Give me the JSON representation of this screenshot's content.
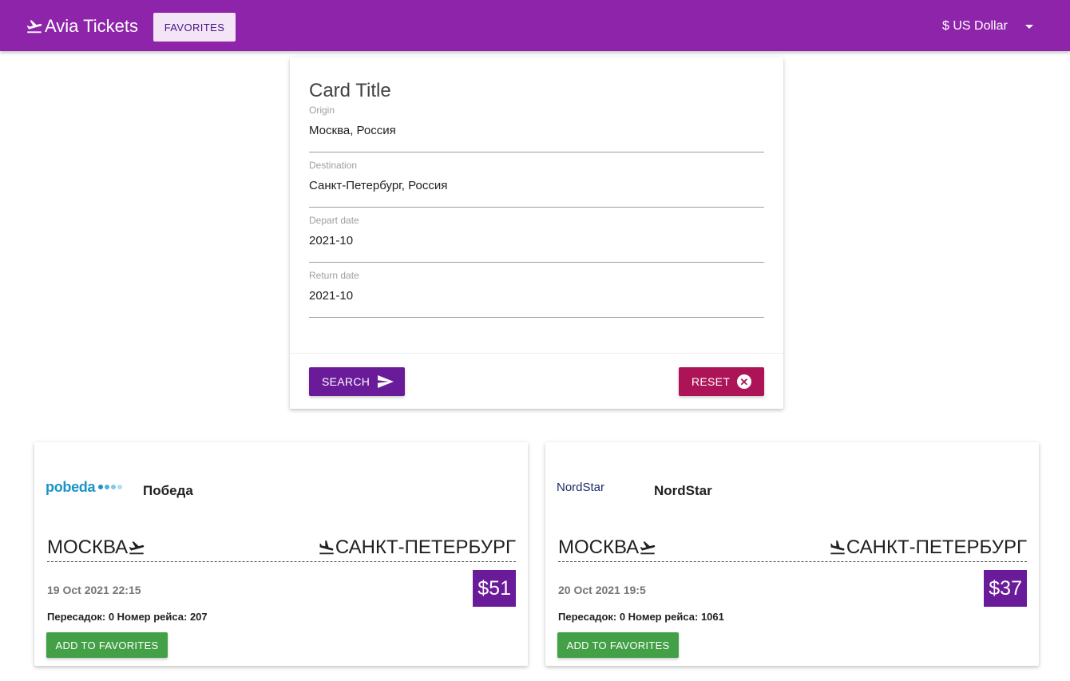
{
  "header": {
    "brand": "Avia Tickets",
    "brand_icon": "airplane-takeoff-icon",
    "favorites_label": "FAVORITES",
    "currency_label": "$ US Dollar",
    "bg_color": "#8e24aa"
  },
  "form": {
    "title": "Card Title",
    "fields": [
      {
        "label": "Origin",
        "value": "Москва, Россия"
      },
      {
        "label": "Destination",
        "value": "Санкт-Петербург, Россия"
      },
      {
        "label": "Depart date",
        "value": "2021-10"
      },
      {
        "label": "Return date",
        "value": "2021-10"
      }
    ],
    "search_label": "SEARCH",
    "reset_label": "RESET",
    "search_color": "#6a1b9a",
    "reset_color": "#ad1457"
  },
  "tickets": [
    {
      "logo_text": "pobeda",
      "airline": "Победа",
      "origin": "МОСКВА",
      "destination": "САНКТ-ПЕТЕРБУРГ",
      "date": "19 Oct 2021 22:15",
      "price": "$51",
      "meta": "Пересадок: 0 Номер рейса: 207",
      "add_label": "ADD TO FAVORITES"
    },
    {
      "logo_text": "NordStar",
      "airline": "NordStar",
      "origin": "МОСКВА",
      "destination": "САНКТ-ПЕТЕРБУРГ",
      "date": "20 Oct 2021 19:5",
      "price": "$37",
      "meta": "Пересадок: 0 Номер рейса: 1061",
      "add_label": "ADD TO FAVORITES"
    }
  ]
}
